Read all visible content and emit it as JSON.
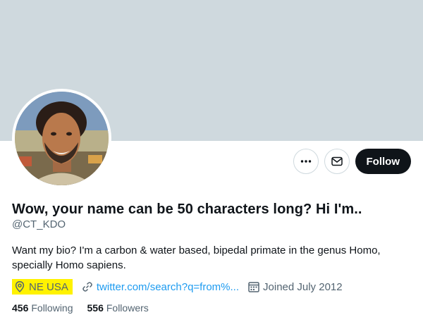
{
  "profile": {
    "display_name": "Wow, your name can be 50 characters long? Hi I'm..",
    "handle": "@CT_KDO",
    "bio": "Want my bio?  I'm a carbon & water based, bipedal primate in the genus Homo, specially Homo sapiens.",
    "location": "NE USA",
    "website": "twitter.com/search?q=from%...",
    "joined": "Joined July 2012",
    "following_count": "456",
    "following_label": "Following",
    "followers_count": "556",
    "followers_label": "Followers"
  },
  "actions": {
    "more_icon": "more-icon",
    "message_icon": "envelope-icon",
    "follow_label": "Follow"
  },
  "colors": {
    "banner": "#cfd9de",
    "link": "#1d9bf0",
    "highlight": "#fff200",
    "follow_button": "#0f1419"
  }
}
